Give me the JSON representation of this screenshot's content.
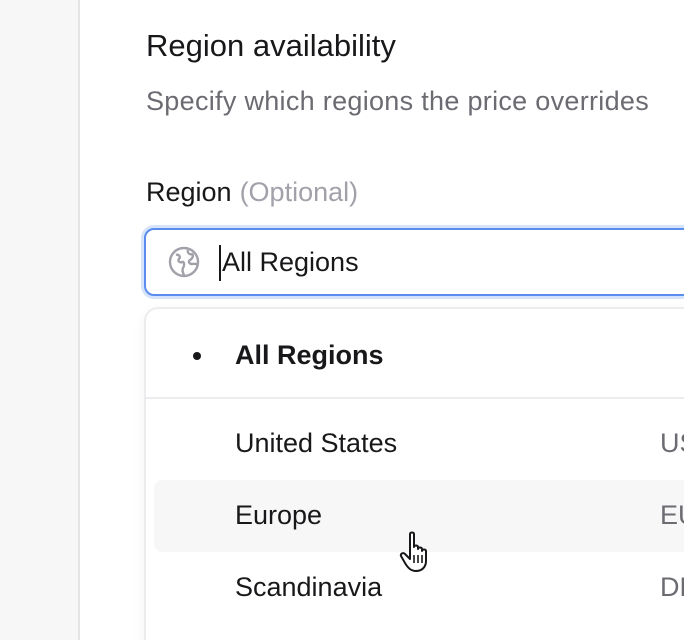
{
  "section": {
    "title": "Region availability",
    "description": "Specify which regions the price overrides"
  },
  "field": {
    "label": "Region",
    "optional_text": "(Optional)",
    "value": "All Regions",
    "icon": "globe-icon",
    "focus_color": "#5b8def"
  },
  "dropdown": {
    "selected": {
      "label": "All Regions"
    },
    "options": [
      {
        "label": "United States",
        "code": "US"
      },
      {
        "label": "Europe",
        "code": "EU"
      },
      {
        "label": "Scandinavia",
        "code": "DK"
      }
    ],
    "hovered_index": 1
  },
  "cursor": {
    "icon": "hand-pointer-icon"
  }
}
